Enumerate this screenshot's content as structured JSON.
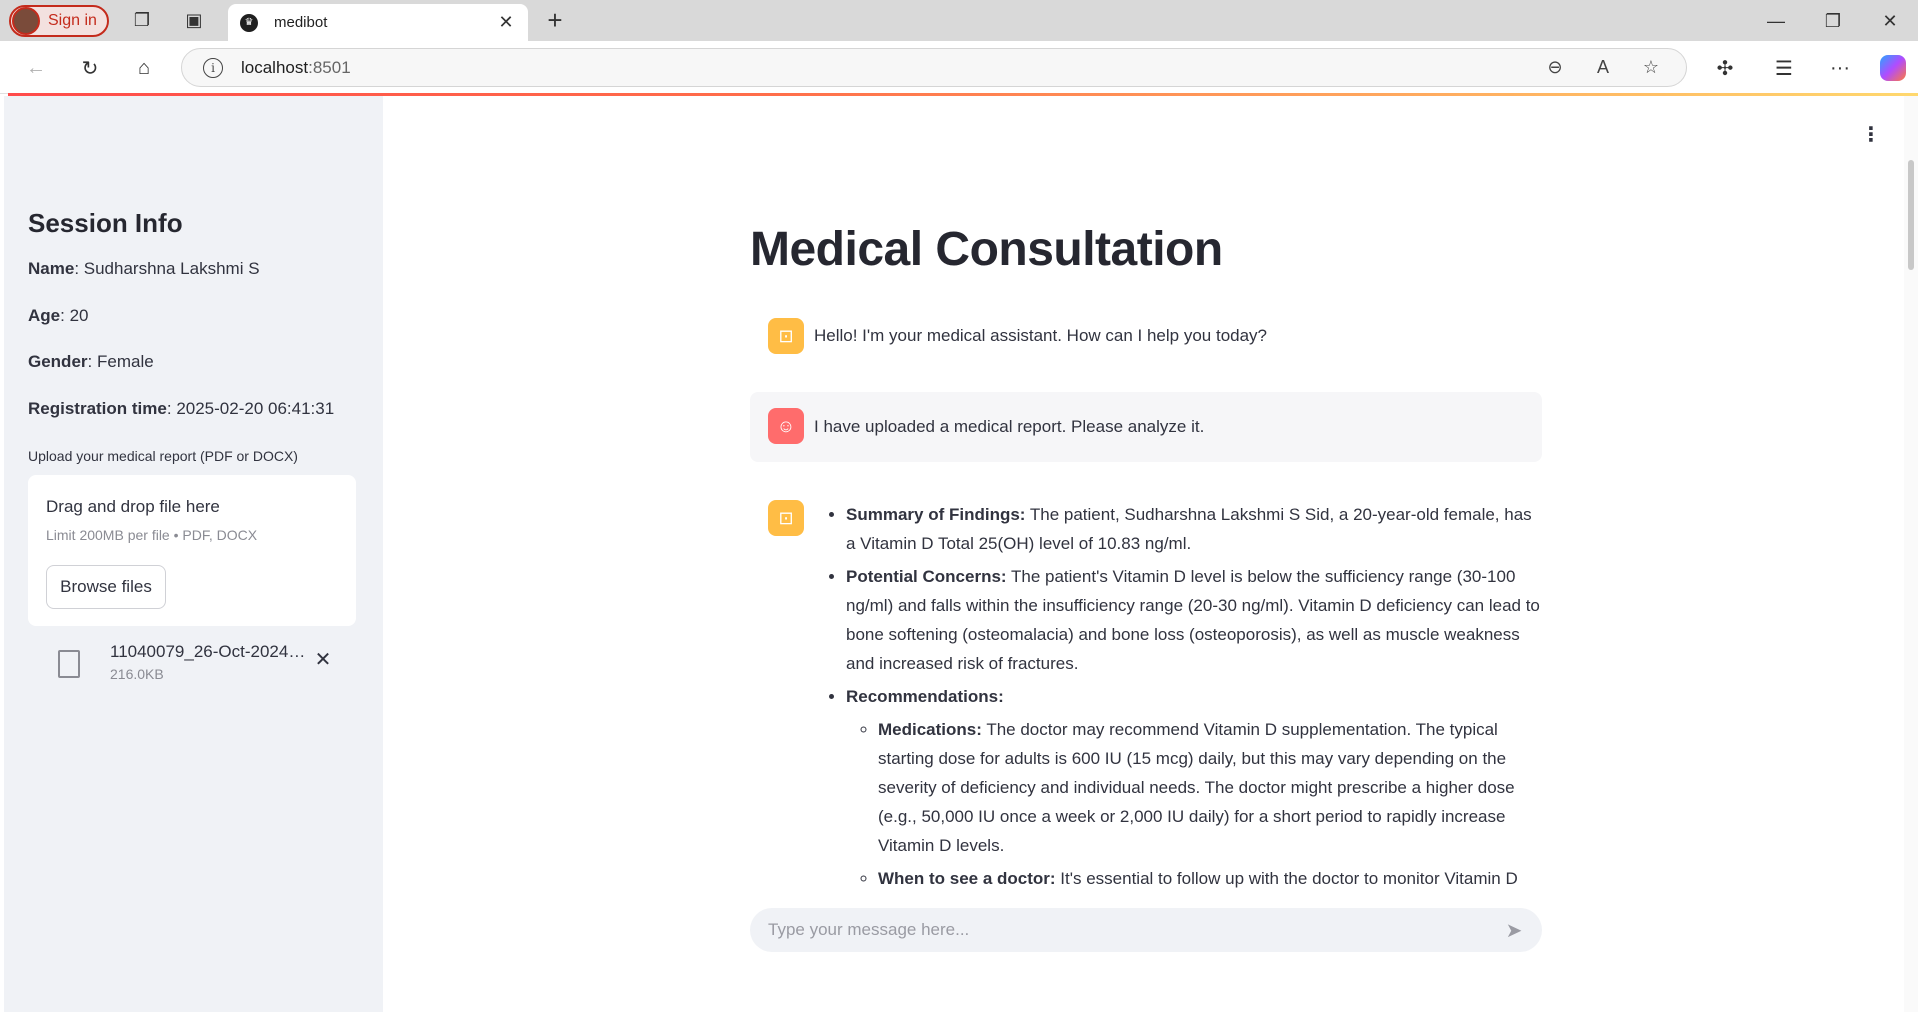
{
  "browser": {
    "profile_label": "Sign in",
    "tab_title": "medibot",
    "url_host": "localhost",
    "url_port": ":8501"
  },
  "sidebar": {
    "title": "Session Info",
    "fields": [
      {
        "key": "Name",
        "value": "Sudharshna Lakshmi S"
      },
      {
        "key": "Age",
        "value": "20"
      },
      {
        "key": "Gender",
        "value": "Female"
      },
      {
        "key": "Registration time",
        "value": "2025-02-20 06:41:31"
      }
    ],
    "upload_label": "Upload your medical report (PDF or DOCX)",
    "dropzone_title": "Drag and drop file here",
    "dropzone_sub": "Limit 200MB per file • PDF, DOCX",
    "browse_label": "Browse files",
    "file": {
      "name": "11040079_26-Oct-2024 (...",
      "size": "216.0KB"
    }
  },
  "main": {
    "title": "Medical Consultation",
    "messages": [
      {
        "role": "assistant",
        "text": "Hello! I'm your medical assistant. How can I help you today?"
      },
      {
        "role": "user",
        "text": "I have uploaded a medical report. Please analyze it."
      }
    ],
    "response": {
      "summary_label": "Summary of Findings:",
      "summary_text": " The patient, Sudharshna Lakshmi S Sid, a 20-year-old female, has a Vitamin D Total 25(OH) level of 10.83 ng/ml.",
      "concerns_label": "Potential Concerns:",
      "concerns_text": " The patient's Vitamin D level is below the sufficiency range (30-100 ng/ml) and falls within the insufficiency range (20-30 ng/ml). Vitamin D deficiency can lead to bone softening (osteomalacia) and bone loss (osteoporosis), as well as muscle weakness and increased risk of fractures.",
      "recommendations_label": "Recommendations:",
      "medications_label": "Medications:",
      "medications_text": " The doctor may recommend Vitamin D supplementation. The typical starting dose for adults is 600 IU (15 mcg) daily, but this may vary depending on the severity of deficiency and individual needs. The doctor might prescribe a higher dose (e.g., 50,000 IU once a week or 2,000 IU daily) for a short period to rapidly increase Vitamin D levels.",
      "doctor_label": "When to see a doctor:",
      "doctor_text": " It's essential to follow up with the doctor to monitor Vitamin D"
    },
    "input_placeholder": "Type your message here..."
  },
  "colors": {
    "sidebar_bg": "#f0f2f6",
    "bot_avatar": "#ffbd45",
    "user_avatar": "#ff6c6c",
    "accent": "#ff4b4b"
  }
}
